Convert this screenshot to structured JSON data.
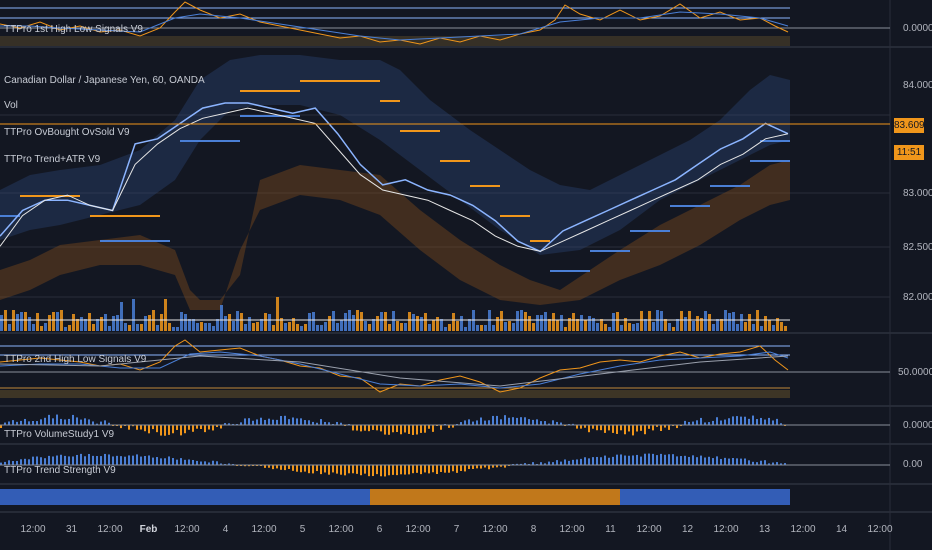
{
  "colors": {
    "background": "#131722",
    "orange": "#f0961b",
    "blue": "#4a7fd6",
    "light_blue": "#8bb4ff",
    "white_line": "#e6e6e6",
    "grid": "#2a2e39",
    "separator": "#3a3f4c"
  },
  "panes": {
    "top_indicator": {
      "label": "TTPro 1st High Low Signals V9",
      "axis_value": "0.0000"
    },
    "main": {
      "symbol_title": "Canadian Dollar / Japanese Yen, 60, OANDA",
      "labels": [
        "Vol",
        "TTPro OvBought OvSold V9",
        "TTPro Trend+ATR V9"
      ],
      "axis_values": [
        "84.000",
        "83.500",
        "83.000",
        "82.500",
        "82.000"
      ],
      "current_price": "83.609",
      "countdown": "11:51"
    },
    "second_indicator": {
      "label": "TTPro 2nd High Low Signals V9",
      "axis_value": "50.0000"
    },
    "volume_study": {
      "label": "TTPro VolumeStudy1 V9",
      "axis_value": "0.0000"
    },
    "trend_strength": {
      "label": "TTPro Trend Strength V9",
      "axis_value": "0.00"
    }
  },
  "time_axis": [
    {
      "text": "12:00",
      "bold": false
    },
    {
      "text": "31",
      "bold": false
    },
    {
      "text": "12:00",
      "bold": false
    },
    {
      "text": "Feb",
      "bold": true
    },
    {
      "text": "12:00",
      "bold": false
    },
    {
      "text": "4",
      "bold": false
    },
    {
      "text": "12:00",
      "bold": false
    },
    {
      "text": "5",
      "bold": false
    },
    {
      "text": "12:00",
      "bold": false
    },
    {
      "text": "6",
      "bold": false
    },
    {
      "text": "12:00",
      "bold": false
    },
    {
      "text": "7",
      "bold": false
    },
    {
      "text": "12:00",
      "bold": false
    },
    {
      "text": "8",
      "bold": false
    },
    {
      "text": "12:00",
      "bold": false
    },
    {
      "text": "11",
      "bold": false
    },
    {
      "text": "12:00",
      "bold": false
    },
    {
      "text": "12",
      "bold": false
    },
    {
      "text": "12:00",
      "bold": false
    },
    {
      "text": "13",
      "bold": false
    },
    {
      "text": "12:00",
      "bold": false
    },
    {
      "text": "14",
      "bold": false
    },
    {
      "text": "12:00",
      "bold": false
    }
  ],
  "chart_data": {
    "type": "line",
    "title": "Canadian Dollar / Japanese Yen, 60, OANDA",
    "xlabel": "",
    "ylabel": "",
    "ylim": [
      81.8,
      84.3
    ],
    "grid": true,
    "x": [
      "Jan 30 12:00",
      "Jan 31",
      "Jan 31 12:00",
      "Feb 1",
      "Feb 1 12:00",
      "Feb 4",
      "Feb 4 12:00",
      "Feb 5",
      "Feb 5 12:00",
      "Feb 6",
      "Feb 6 12:00",
      "Feb 7",
      "Feb 7 12:00",
      "Feb 8",
      "Feb 8 12:00",
      "Feb 11",
      "Feb 11 12:00",
      "Feb 12",
      "Feb 12 12:00",
      "Feb 13",
      "Feb 13 12:00"
    ],
    "series": [
      {
        "values": [
          82.6,
          82.85,
          82.95,
          82.95,
          82.9,
          82.85,
          83.5,
          83.55,
          83.7,
          83.85,
          83.9,
          83.9,
          83.85,
          83.8,
          83.85,
          83.6,
          83.3,
          83.1,
          83.15,
          83.05,
          83.0,
          82.9,
          82.75,
          82.55,
          82.45,
          82.65,
          82.75,
          82.85,
          82.95,
          83.05,
          83.15,
          83.3,
          83.45,
          83.55,
          83.7,
          83.6
        ]
      },
      {
        "values": [
          82.5,
          82.8,
          82.95,
          83.0,
          82.9,
          82.85,
          83.3,
          83.5,
          83.65,
          83.75,
          83.8,
          83.85,
          83.8,
          83.75,
          83.7,
          83.45,
          83.2,
          83.05,
          83.0,
          82.95,
          82.85,
          82.75,
          82.6,
          82.5,
          82.45,
          82.55,
          82.65,
          82.75,
          82.85,
          82.95,
          83.05,
          83.15,
          83.3,
          83.4,
          83.55,
          83.6
        ]
      }
    ]
  }
}
